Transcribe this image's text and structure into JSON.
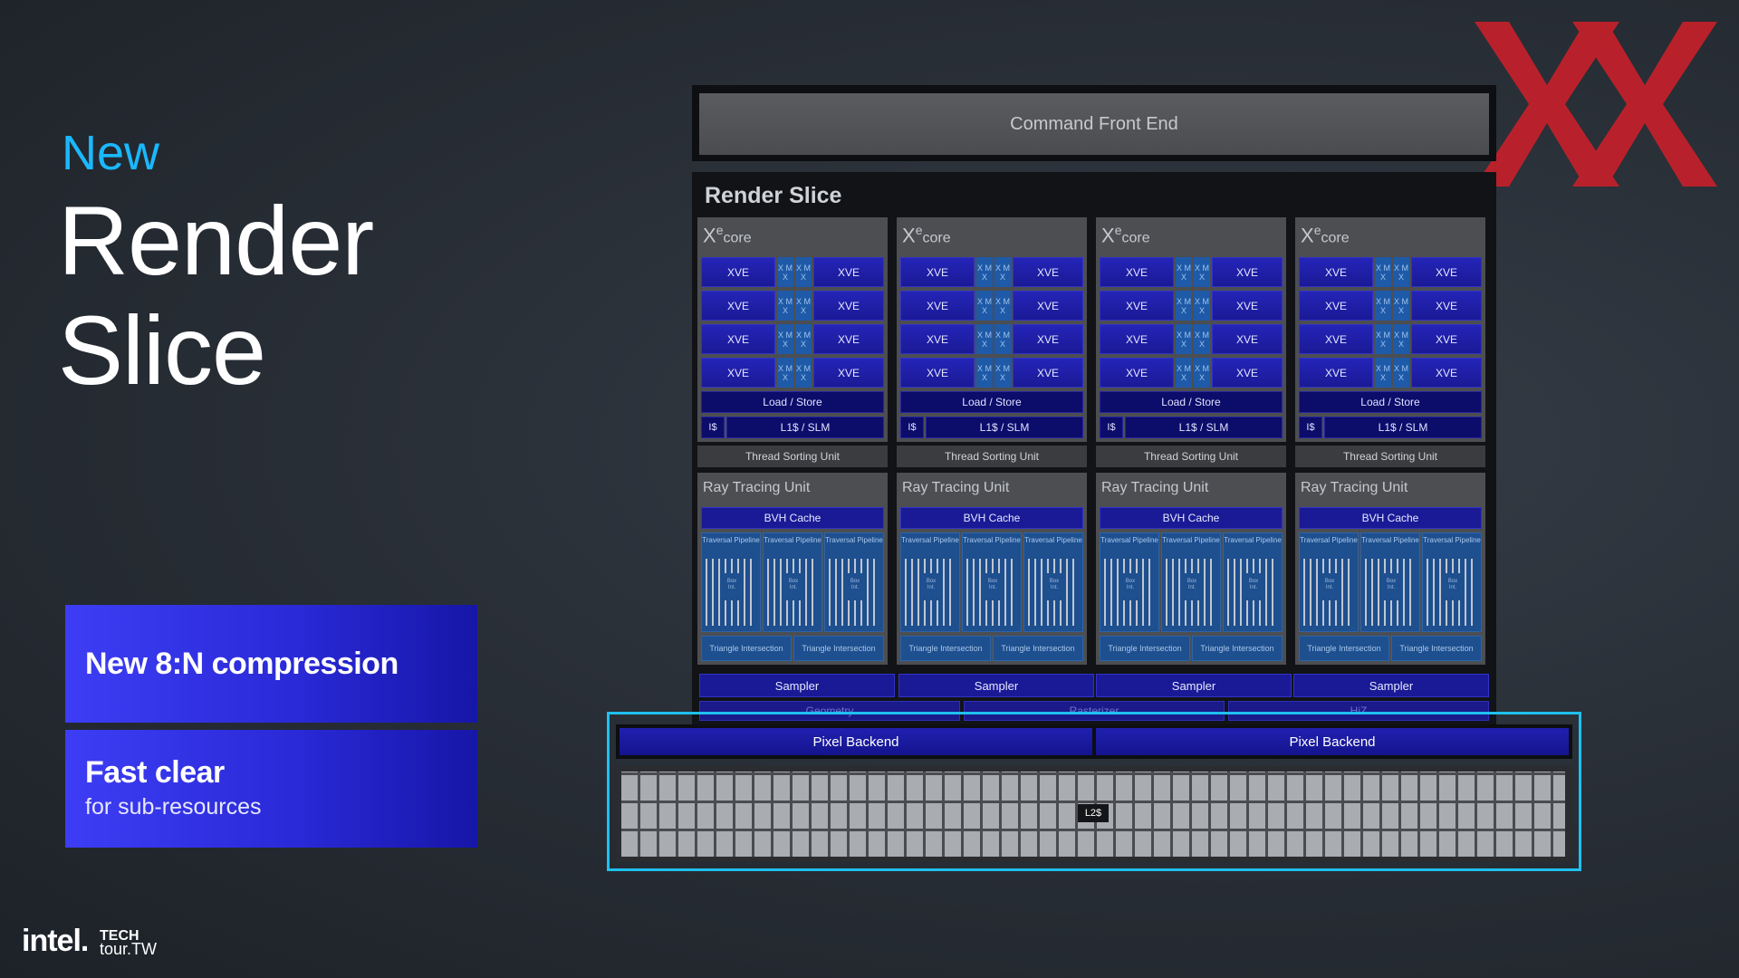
{
  "title": {
    "new": "New",
    "line1": "Render",
    "line2": "Slice"
  },
  "features": [
    {
      "main": "New 8:N compression",
      "sub": ""
    },
    {
      "main": "Fast clear",
      "sub": "for sub-resources"
    }
  ],
  "logos": {
    "intel": "intel.",
    "techtour_line1": "TECH",
    "techtour_line2": "tour.TW"
  },
  "diagram": {
    "command_front_end": "Command Front End",
    "render_slice": "Render Slice",
    "xe_prefix": "X",
    "xe_sup": "e",
    "xe_core": "core",
    "xve": "XVE",
    "xmx": "X M X",
    "load_store": "Load / Store",
    "is": "I$",
    "l1_slm": "L1$ / SLM",
    "thread_sorting_unit": "Thread Sorting Unit",
    "ray_tracing_unit": "Ray Tracing Unit",
    "bvh_cache": "BVH Cache",
    "traversal_pipeline": "Traversal Pipeline",
    "box_int": "Box Int.",
    "triangle_intersection": "Triangle Intersection",
    "sampler": "Sampler",
    "geometry": "Geometry",
    "rasterizer": "Rasterizer",
    "hiz": "HiZ",
    "pixel_backend": "Pixel Backend",
    "l2": "L2$"
  },
  "colors": {
    "accent_cyan": "#1fc0f0",
    "title_blue": "#1ab8ff",
    "unit_blue": "#1a1a96",
    "watermark_red": "#c8202a"
  }
}
